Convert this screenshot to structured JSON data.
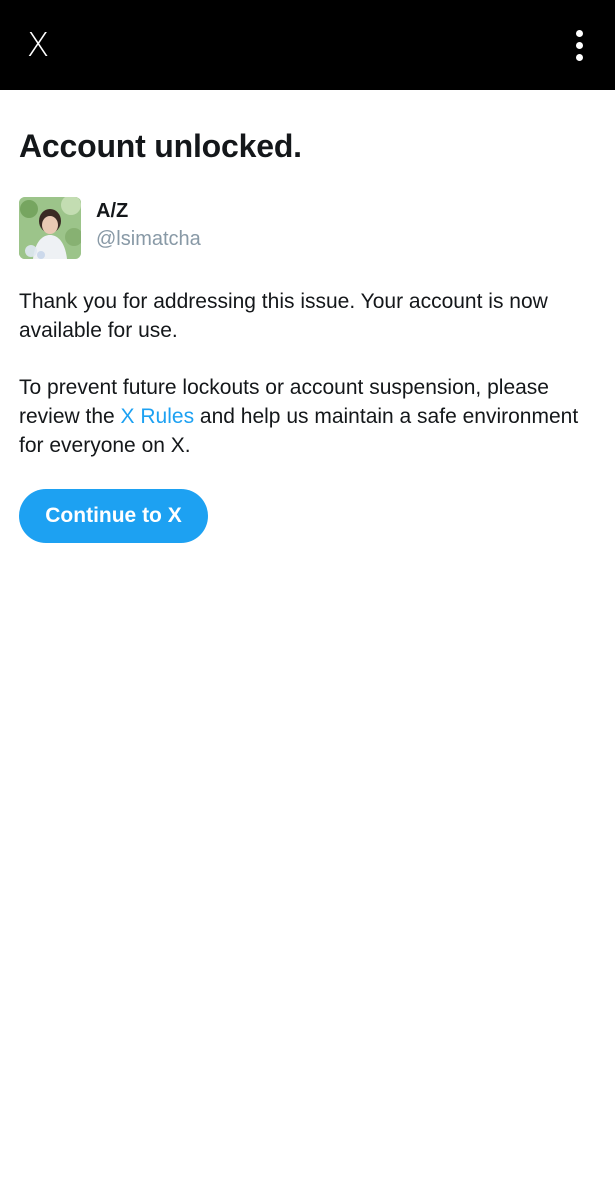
{
  "topbar": {
    "close_label": "X",
    "close_icon": "close-icon",
    "menu_icon": "more-vertical-icon",
    "background": "#000000"
  },
  "title": "Account unlocked.",
  "profile": {
    "display_name": "A/Z",
    "handle": "@lsimatcha"
  },
  "message": {
    "para1": "Thank you for addressing this issue. Your account is now available for use.",
    "para2_before": "To prevent future lockouts or account suspension, please review the ",
    "para2_link": "X Rules",
    "para2_after": " and help us maintain a safe environment for everyone on X."
  },
  "continue_button": {
    "label": "Continue to X",
    "color": "#1da1f2"
  },
  "colors": {
    "accent": "#1da1f2",
    "text": "#14171a",
    "muted": "#8899a6"
  }
}
